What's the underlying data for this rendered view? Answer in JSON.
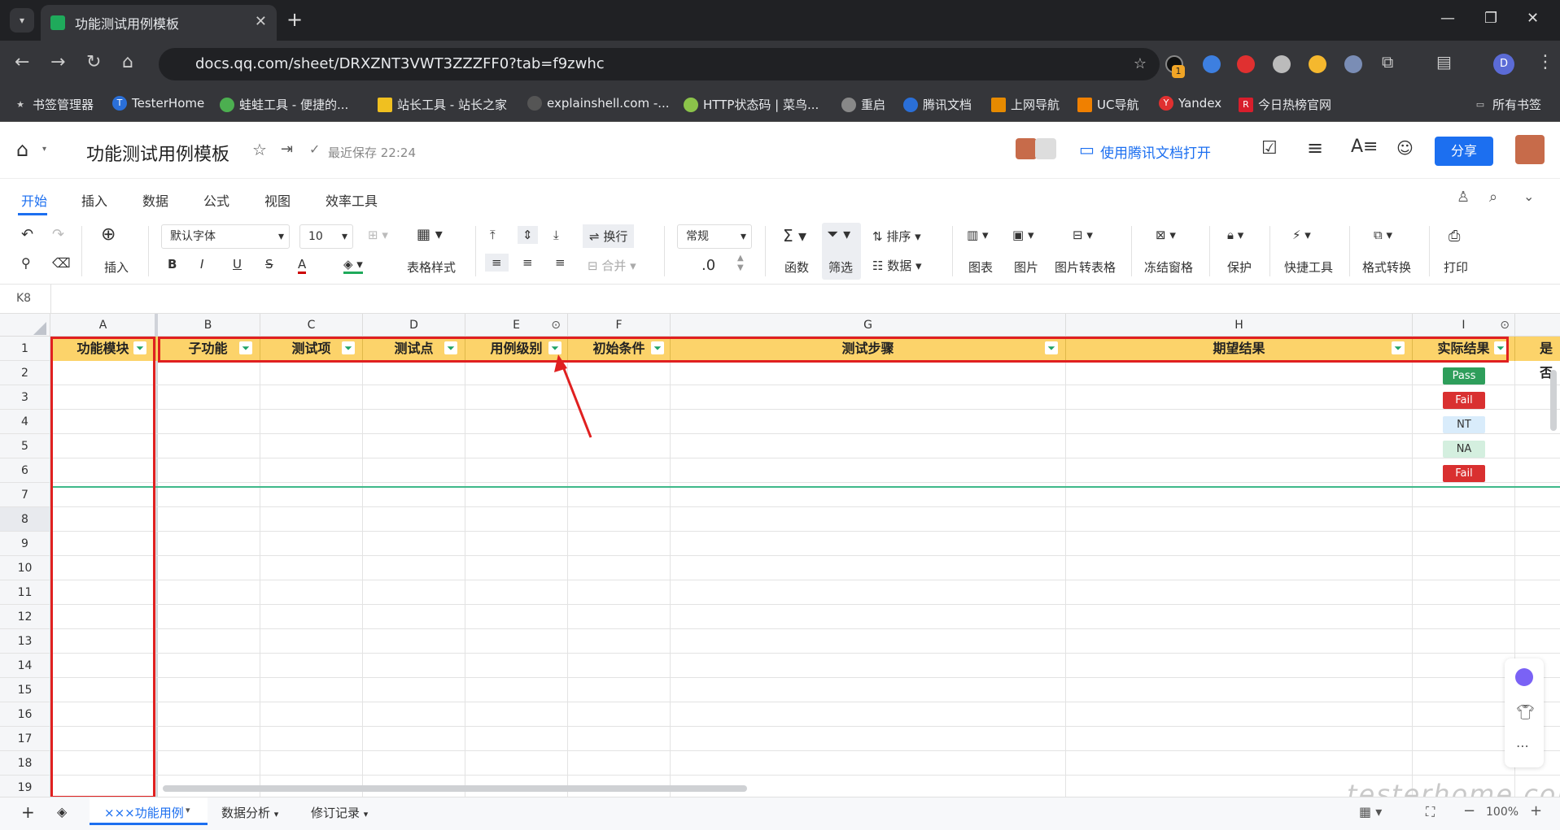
{
  "browser": {
    "tab_title": "功能测试用例模板",
    "url": "docs.qq.com/sheet/DRXZNT3VWT3ZZZFF0?tab=f9zwhc",
    "profile_initial": "D",
    "extension_badge": "1",
    "bookmarks": [
      "书签管理器",
      "TesterHome",
      "蛙蛙工具 - 便捷的...",
      "站长工具 - 站长之家",
      "explainshell.com -...",
      "HTTP状态码 | 菜鸟...",
      "重启",
      "腾讯文档",
      "上网导航",
      "UC导航",
      "Yandex",
      "今日热榜官网"
    ],
    "all_bookmarks": "所有书签"
  },
  "doc": {
    "title": "功能测试用例模板",
    "save_status": "最近保存 22:24",
    "open_in_app": "使用腾讯文档打开",
    "share": "分享"
  },
  "menu_tabs": [
    "开始",
    "插入",
    "数据",
    "公式",
    "视图",
    "效率工具"
  ],
  "toolbar": {
    "insert": "插入",
    "font": "默认字体",
    "font_size": "10",
    "table_style": "表格样式",
    "wrap": "换行",
    "merge": "合并",
    "number_format": "常规",
    "decimal": ".0",
    "function": "函数",
    "filter": "筛选",
    "sort": "排序",
    "data": "数据",
    "chart": "图表",
    "image": "图片",
    "image_to_table": "图片转表格",
    "freeze": "冻结窗格",
    "protect": "保护",
    "quick_tools": "快捷工具",
    "format_convert": "格式转换",
    "print": "打印",
    "bold": "B",
    "italic": "I",
    "underline": "U",
    "strike": "S",
    "font_color": "A"
  },
  "cell_ref": "K8",
  "columns": [
    "A",
    "B",
    "C",
    "D",
    "E",
    "F",
    "G",
    "H",
    "I"
  ],
  "header_cells": [
    "功能模块",
    "子功能",
    "测试项",
    "测试点",
    "用例级别",
    "初始条件",
    "测试步骤",
    "期望结果",
    "实际结果",
    "是否"
  ],
  "rows": [
    "1",
    "2",
    "3",
    "4",
    "5",
    "6",
    "7",
    "8",
    "9",
    "10",
    "11",
    "12",
    "13",
    "14",
    "15",
    "16",
    "17",
    "18",
    "19"
  ],
  "results": [
    "Pass",
    "Fail",
    "NT",
    "NA",
    "Fail"
  ],
  "sheets": [
    "×××功能用例",
    "数据分析",
    "修订记录"
  ],
  "zoom": "100%",
  "watermark": "testerhome.com",
  "colors": {
    "accent": "#1c6ff0",
    "header_fill": "#fcd36a",
    "pass": "#2e9e5b",
    "fail": "#d93030",
    "nt": "#d9ecfb",
    "na": "#d4efdf",
    "annotation": "#e02020"
  }
}
